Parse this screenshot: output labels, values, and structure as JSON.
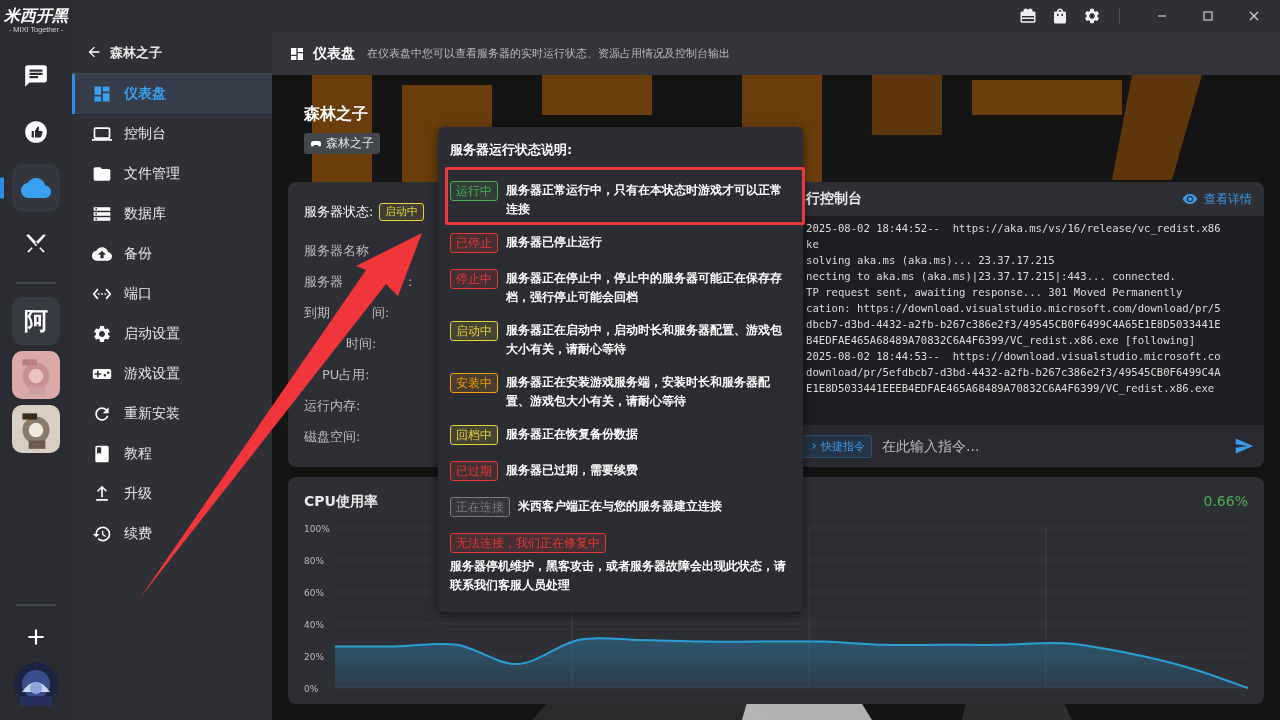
{
  "app": {
    "logo": "米西开黑",
    "logo_sub": "- MIXI Together -"
  },
  "rail": {
    "items": [
      {
        "kind": "icon",
        "selected": false
      },
      {
        "kind": "icon",
        "selected": false
      },
      {
        "kind": "icon",
        "selected": true
      },
      {
        "kind": "icon",
        "selected": false
      }
    ],
    "servers": [
      {
        "kind": "letter",
        "label": "阿",
        "selected": false
      },
      {
        "kind": "picture",
        "selected": false
      },
      {
        "kind": "picture",
        "selected": false
      }
    ]
  },
  "sidebar": {
    "back_title": "森林之子",
    "items": [
      {
        "label": "仪表盘",
        "selected": true
      },
      {
        "label": "控制台",
        "selected": false
      },
      {
        "label": "文件管理",
        "selected": false
      },
      {
        "label": "数据库",
        "selected": false
      },
      {
        "label": "备份",
        "selected": false
      },
      {
        "label": "端口",
        "selected": false
      },
      {
        "label": "启动设置",
        "selected": false
      },
      {
        "label": "游戏设置",
        "selected": false
      },
      {
        "label": "重新安装",
        "selected": false
      },
      {
        "label": "教程",
        "selected": false
      },
      {
        "label": "升级",
        "selected": false
      },
      {
        "label": "续费",
        "selected": false
      }
    ]
  },
  "header": {
    "title": "仪表盘",
    "description": "在仪表盘中您可以查看服务器的实时运行状态、资源占用情况及控制台输出"
  },
  "server": {
    "name": "森林之子",
    "game_tag": "森林之子",
    "status_label": "服务器状态:",
    "status": {
      "text": "启动中",
      "color": "#e6d23c"
    },
    "fields": [
      [
        "服务器名称"
      ],
      [
        "服务器",
        ":"
      ],
      [
        "到期",
        "间:"
      ],
      [
        "时间:"
      ],
      [
        "PU占用:"
      ],
      [
        "运行内存:"
      ],
      [
        "磁盘空间:"
      ]
    ]
  },
  "console": {
    "title": "行控制台",
    "details_link": "查看详情",
    "lines": [
      "2025-08-02 18:44:52--  https://aka.ms/vs/16/release/vc_redist.x86",
      "ke",
      "solving aka.ms (aka.ms)... 23.37.17.215",
      "necting to aka.ms (aka.ms)|23.37.17.215|:443... connected.",
      "TP request sent, awaiting response... 301 Moved Permanently",
      "cation: https://download.visualstudio.microsoft.com/download/pr/5",
      "dbcb7-d3bd-4432-a2fb-b267c386e2f3/49545CB0F6499C4A65E1E8D5033441E",
      "B4EDFAE465A68489A70832C6A4F6399/VC_redist.x86.exe [following]",
      "2025-08-02 18:44:53--  https://download.visualstudio.microsoft.co",
      "download/pr/5efdbcb7-d3bd-4432-a2fb-b267c386e2f3/49545CB0F6499C4A",
      "E1E8D5033441EEEB4EDFAE465A68489A70832C6A4F6399/VC_redist.x86.exe"
    ],
    "quick_button": "快捷指令",
    "input_placeholder": "在此输入指令..."
  },
  "cpu": {
    "title": "CPU使用率",
    "reading": "0.66%",
    "chart_data": {
      "type": "area",
      "grid": true,
      "ylim": [
        0,
        100
      ],
      "yticks": [
        {
          "value": 0,
          "label": "0%"
        },
        {
          "value": 20,
          "label": "20%"
        },
        {
          "value": 40,
          "label": "40%"
        },
        {
          "value": 60,
          "label": "60%"
        },
        {
          "value": 80,
          "label": "80%"
        },
        {
          "value": 100,
          "label": "100%"
        }
      ],
      "series": [
        {
          "color": "#2a9fd6",
          "values": [
            26,
            26,
            27,
            15,
            30,
            30,
            29,
            29,
            29,
            27,
            27,
            27,
            28,
            22,
            13,
            0
          ]
        }
      ]
    }
  },
  "popup": {
    "title": "服务器运行状态说明:",
    "items": [
      {
        "kind": "inline",
        "tag": "运行中",
        "color": "#4caf50",
        "text": "服务器正常运行中，只有在本状态时游戏才可以正常连接",
        "highlighted": true
      },
      {
        "kind": "inline",
        "tag": "已停止",
        "color": "#e53935",
        "text": "服务器已停止运行",
        "highlighted": false
      },
      {
        "kind": "inline",
        "tag": "停止中",
        "color": "#e53935",
        "text": "服务器正在停止中，停止中的服务器可能正在保存存档，强行停止可能会回档",
        "highlighted": false
      },
      {
        "kind": "inline",
        "tag": "启动中",
        "color": "#e6d23c",
        "text": "服务器正在启动中，启动时长和服务器配置、游戏包大小有关，请耐心等待",
        "highlighted": false
      },
      {
        "kind": "inline",
        "tag": "安装中",
        "color": "#f59e0b",
        "text": "服务器正在安装游戏服务端，安装时长和服务器配置、游戏包大小有关，请耐心等待",
        "highlighted": false
      },
      {
        "kind": "inline",
        "tag": "回档中",
        "color": "#e6d23c",
        "text": "服务器正在恢复备份数据",
        "highlighted": false
      },
      {
        "kind": "inline",
        "tag": "已过期",
        "color": "#e53935",
        "text": "服务器已过期，需要续费",
        "highlighted": false
      },
      {
        "kind": "inline",
        "tag": "正在连接",
        "color": "#7a7a7a",
        "text": "米西客户端正在与您的服务器建立连接",
        "highlighted": false
      },
      {
        "kind": "stacked",
        "tag": "无法连接，我们正在修复中",
        "color": "#e53935",
        "text": "服务器停机维护，黑客攻击，或者服务器故障会出现此状态，请联系我们客服人员处理",
        "highlighted": false
      }
    ]
  }
}
